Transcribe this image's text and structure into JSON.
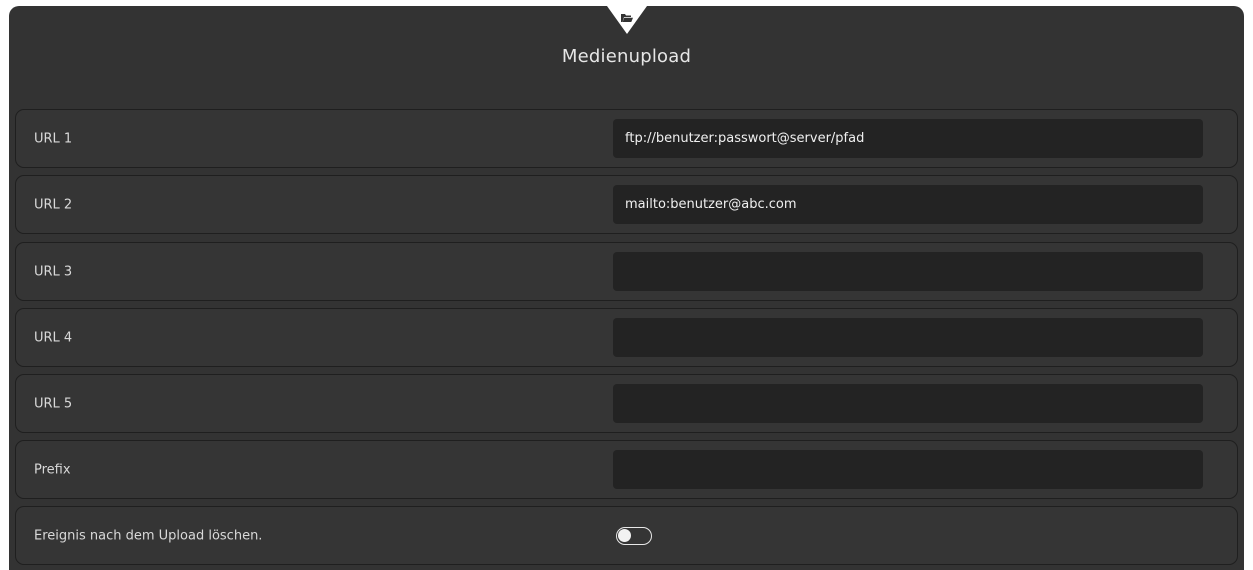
{
  "header": {
    "title": "Medienupload",
    "icon": "folder-open-icon"
  },
  "rows": [
    {
      "label": "URL 1",
      "value": "ftp://benutzer:passwort@server/pfad"
    },
    {
      "label": "URL 2",
      "value": "mailto:benutzer@abc.com"
    },
    {
      "label": "URL 3",
      "value": ""
    },
    {
      "label": "URL 4",
      "value": ""
    },
    {
      "label": "URL 5",
      "value": ""
    },
    {
      "label": "Prefix",
      "value": ""
    }
  ],
  "delete_after_upload": {
    "label": "Ereignis nach dem Upload löschen.",
    "enabled": false
  },
  "colors": {
    "panel": "#333333",
    "row_border": "#1f1f1f",
    "input_bg": "#232323",
    "text": "#e6e6e6"
  }
}
